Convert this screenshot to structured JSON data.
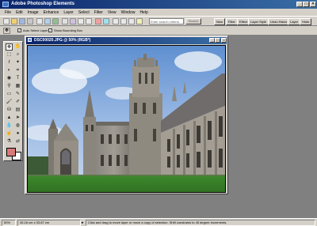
{
  "window": {
    "title": "Adobe Photoshop Elements"
  },
  "window_controls": {
    "minimize": "_",
    "maximize": "□",
    "close": "×"
  },
  "menu": [
    "File",
    "Edit",
    "Image",
    "Enhance",
    "Layer",
    "Select",
    "Filter",
    "View",
    "Window",
    "Help"
  ],
  "shortcuts": {
    "search_placeholder": "Enter search criteria",
    "search_button": "Search",
    "palette_tabs": [
      "New",
      "Filter",
      "Effect",
      "Layer Style",
      "Undo Histor",
      "Layer",
      "Hints"
    ]
  },
  "options": {
    "auto_select_label": "Auto Select Layer",
    "auto_select_checked": "✓",
    "bounding_box_label": "Show Bounding Box",
    "bounding_box_checked": "✓"
  },
  "document": {
    "title": "DSC00020.JPG @ 50% (RGB*)",
    "controls": {
      "minimize": "_",
      "maximize": "□",
      "close": "×"
    }
  },
  "status": {
    "zoom": "50%",
    "size": "45.16 cm x 33.87 cm",
    "hint": "Click and drag to move layer or move a copy of selection. Shift constrains to 45 degree increments."
  },
  "colors": {
    "foreground": "#d97a7a",
    "background": "#ffffff",
    "title_bar": "#0a246a",
    "chrome": "#d4d0c8"
  }
}
